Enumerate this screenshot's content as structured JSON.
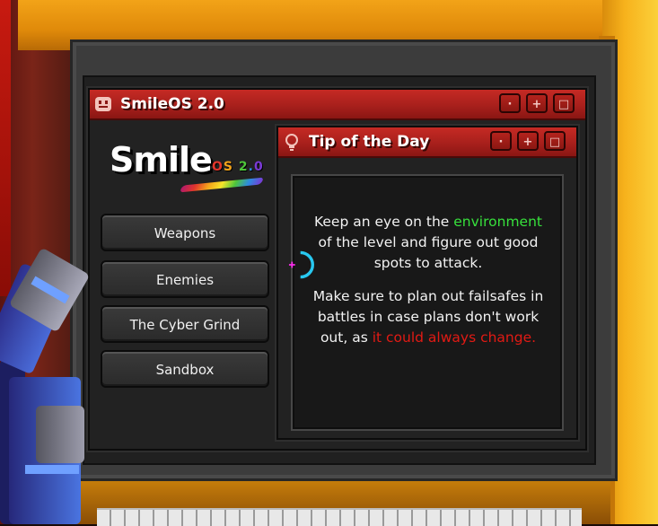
{
  "main_window": {
    "title": "SmileOS 2.0",
    "icon": "smiley-icon",
    "buttons": [
      "minimize",
      "maximize",
      "close"
    ]
  },
  "logo": {
    "word": "Smile",
    "version": "OS 2.0",
    "colors": [
      "#e0362c",
      "#f4a31a",
      "#f6e52a",
      "#4ec63a",
      "#2c8ce0",
      "#7a3ad6"
    ]
  },
  "menu": {
    "items": [
      {
        "label": "Weapons"
      },
      {
        "label": "Enemies"
      },
      {
        "label": "The Cyber Grind"
      },
      {
        "label": "Sandbox"
      }
    ]
  },
  "tip_window": {
    "title": "Tip of the Day",
    "icon": "lightbulb-icon",
    "paragraph1": {
      "before": "Keep an eye on the",
      "highlight": "environment",
      "after": "of the level and figure out good spots to attack."
    },
    "paragraph2": {
      "before": "Make sure to plan out failsafes in battles in case plans don't work out, as",
      "highlight": "it could always change."
    },
    "highlight_colors": {
      "green": "#37e03c",
      "red": "#e21a14"
    }
  },
  "theme": {
    "titlebar_red": "#b3241e",
    "frame_orange": "#f2a318",
    "crosshair_cyan": "#28c8f0",
    "crosshair_magenta": "#ff2cf0"
  }
}
